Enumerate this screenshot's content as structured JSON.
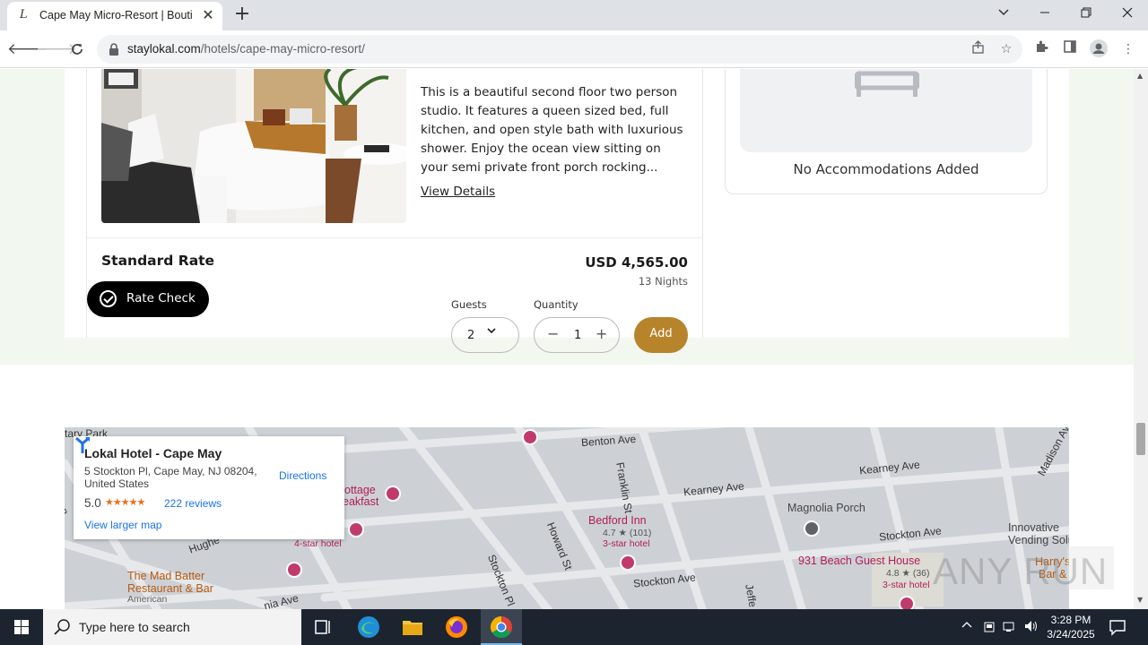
{
  "browser": {
    "tab_title": "Cape May Micro-Resort | Boutique",
    "tab_favicon": "L",
    "url_host": "staylokal.com",
    "url_path": "/hotels/cape-may-micro-resort/"
  },
  "room": {
    "description": "This is a beautiful second floor two person studio. It features a queen sized bed, full kitchen, and open style bath with luxurious shower. Enjoy the ocean view sitting on your semi private front porch rocking...",
    "view_details": "View Details",
    "rate_title": "Standard Rate",
    "rate_check": "Rate Check",
    "price": "USD 4,565.00",
    "nights": "13 Nights",
    "guests_label": "Guests",
    "guests_value": "2",
    "quantity_label": "Quantity",
    "quantity_value": "1",
    "add_label": "Add"
  },
  "sidebar": {
    "empty_text": "No Accommodations Added"
  },
  "map": {
    "info": {
      "title": "Lokal Hotel - Cape May",
      "address_line1": "5 Stockton Pl, Cape May, NJ 08204,",
      "address_line2": "United States",
      "rating": "5.0",
      "stars": "★★★★★",
      "reviews": "222 reviews",
      "larger_map": "View larger map",
      "directions": "Directions"
    },
    "streets": {
      "benton": "Benton Ave",
      "franklin": "Franklin St",
      "kearney1": "Kearney Ave",
      "kearney2": "Kearney Ave",
      "madison": "Madison Ave",
      "howard": "Howard St",
      "stockton_pl": "Stockton Pl",
      "stockton_ave1": "Stockton Ave",
      "stockton_ave2": "Stockton Ave",
      "hughes": "Hughe",
      "virginia": "nia Ave",
      "jeff": "Jeffe",
      "park": "tary Park",
      "lison": "ison"
    },
    "pois": {
      "bedford_inn": "Bedford Inn",
      "bedford_rating": "4.7 ★ (101)",
      "bedford_class": "3-star hotel",
      "magnolia": "Magnolia Porch",
      "beach_guest": "931 Beach Guest House",
      "beach_rating": "4.8 ★ (36)",
      "beach_class": "3-star hotel",
      "mad_batter_1": "The Mad Batter",
      "mad_batter_2": "Restaurant & Bar",
      "mad_batter_3": "American",
      "cottage_1": "ottage",
      "cottage_2": "eakfast",
      "four_star": "4-star hotel",
      "vending_1": "Innovative",
      "vending_2": "Vending Solutio",
      "harry_1": "Harry's",
      "harry_2": "Bar &"
    }
  },
  "watermark": "ANY RUN",
  "taskbar": {
    "search_placeholder": "Type here to search",
    "time": "3:28 PM",
    "date": "3/24/2025"
  }
}
